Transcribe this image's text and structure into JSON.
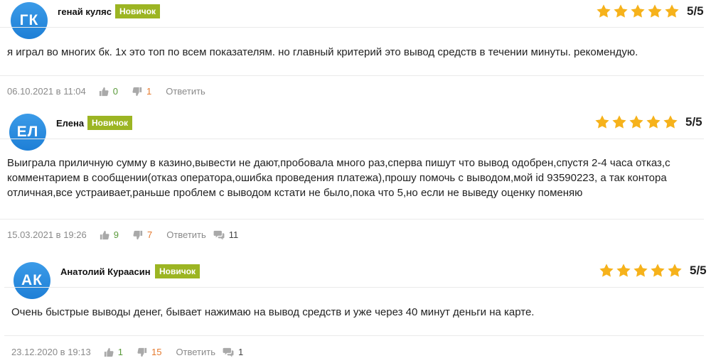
{
  "colors": {
    "accent_avatar": "#2a8ee0",
    "badge": "#9cb523",
    "star": "#f6b21b",
    "likes": "#5a9a3a",
    "dislikes": "#e57a2e"
  },
  "reviews": [
    {
      "initials": "ГК",
      "name": "генай куляс",
      "badge": "Новичок",
      "rating": 5,
      "score": "5/5",
      "text": "я играл во многих бк. 1х это топ по всем показателям. но главный критерий это вывод средств в течении минуты. рекомендую.",
      "date": "06.10.2021 в 11:04",
      "likes": "0",
      "dislikes": "1",
      "reply_label": "Ответить",
      "comments": ""
    },
    {
      "initials": "ЕЛ",
      "name": "Елена",
      "badge": "Новичок",
      "rating": 5,
      "score": "5/5",
      "text": "Выиграла приличную сумму в казино,вывести не дают,пробовала много раз,сперва пишут что вывод одобрен,спустя 2-4 часа отказ,с комментарием в сообщении(отказ оператора,ошибка проведения платежа),прошу помочь с выводом,мой id 93590223, а так контора отличная,все устраивает,раньше проблем с выводом кстати не было,пока что 5,но если не выведу оценку поменяю",
      "date": "15.03.2021 в 19:26",
      "likes": "9",
      "dislikes": "7",
      "reply_label": "Ответить",
      "comments": "11"
    },
    {
      "initials": "АК",
      "name": "Анатолий Кураасин",
      "badge": "Новичок",
      "rating": 5,
      "score": "5/5",
      "text": "Очень быстрые выводы денег, бывает нажимаю на вывод средств и уже через 40 минут деньги на карте.",
      "date": "23.12.2020 в 19:13",
      "likes": "1",
      "dislikes": "15",
      "reply_label": "Ответить",
      "comments": "1"
    }
  ]
}
